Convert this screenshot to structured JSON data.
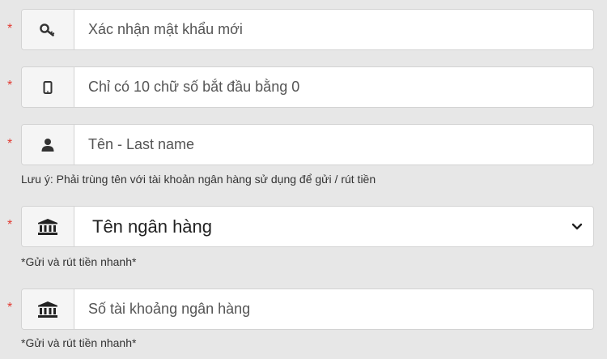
{
  "form": {
    "required_marker": "*",
    "fields": [
      {
        "icon": "key-icon",
        "placeholder": "Xác nhận mật khẩu mới"
      },
      {
        "icon": "mobile-phone-icon",
        "placeholder": "Chỉ có 10 chữ số bắt đầu bằng 0"
      },
      {
        "icon": "user-icon",
        "placeholder": "Tên - Last name",
        "note": "Lưu ý: Phải trùng tên với tài khoản ngân hàng sử dụng để gửi / rút tiền"
      },
      {
        "icon": "bank-icon",
        "selected": "Tên ngân hàng",
        "note": "*Gửi và rút tiền nhanh*"
      },
      {
        "icon": "bank-icon",
        "placeholder": "Số tài khoảng ngân hàng",
        "note": "*Gửi và rút tiền nhanh*"
      }
    ]
  }
}
